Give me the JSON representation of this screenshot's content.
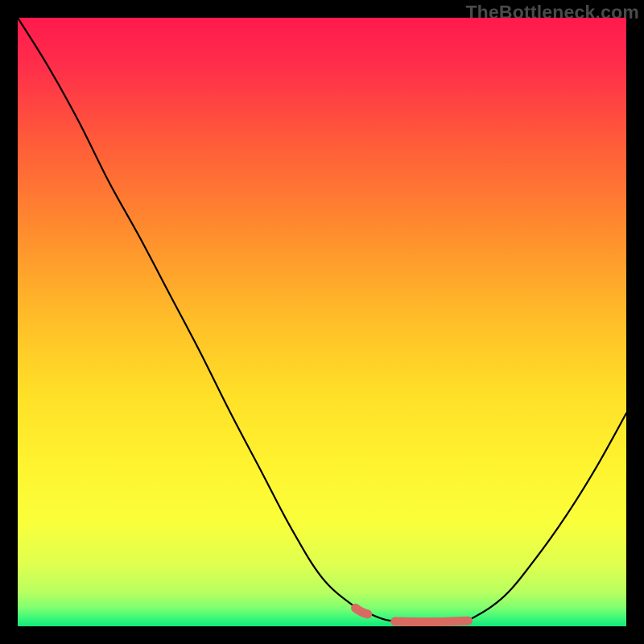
{
  "watermark": "TheBottleneck.com",
  "chart_data": {
    "type": "line",
    "title": "",
    "xlabel": "",
    "ylabel": "",
    "xlim": [
      0,
      100
    ],
    "ylim": [
      0,
      100
    ],
    "grid": false,
    "series": [
      {
        "name": "curve",
        "color": "#000000",
        "x": [
          0,
          5,
          10,
          15,
          20,
          25,
          30,
          35,
          40,
          45,
          50,
          55,
          58,
          60,
          62,
          65,
          68,
          72,
          75,
          80,
          85,
          90,
          95,
          100
        ],
        "y": [
          100,
          92,
          83,
          73,
          64,
          54.5,
          45,
          35,
          25.5,
          16,
          8,
          3.5,
          2,
          1.2,
          0.8,
          0.5,
          0.5,
          0.6,
          1.5,
          5,
          11,
          18,
          26,
          35
        ]
      },
      {
        "name": "highlight",
        "color": "#d96a62",
        "x_ranges": [
          [
            55.5,
            57.5
          ],
          [
            62,
            74
          ]
        ],
        "y_at_ranges": [
          [
            3.0,
            2.0
          ],
          [
            0.8,
            0.9
          ]
        ]
      }
    ],
    "gradient_stops": [
      {
        "offset": 0.0,
        "color": "#ff1a4d"
      },
      {
        "offset": 0.08,
        "color": "#ff2e4a"
      },
      {
        "offset": 0.2,
        "color": "#ff5a3a"
      },
      {
        "offset": 0.35,
        "color": "#ff8c2e"
      },
      {
        "offset": 0.5,
        "color": "#ffbf28"
      },
      {
        "offset": 0.62,
        "color": "#ffe028"
      },
      {
        "offset": 0.74,
        "color": "#fff430"
      },
      {
        "offset": 0.83,
        "color": "#f9ff3a"
      },
      {
        "offset": 0.9,
        "color": "#deff50"
      },
      {
        "offset": 0.945,
        "color": "#b6ff60"
      },
      {
        "offset": 0.97,
        "color": "#7eff70"
      },
      {
        "offset": 0.985,
        "color": "#40f97a"
      },
      {
        "offset": 1.0,
        "color": "#10e87a"
      }
    ]
  }
}
